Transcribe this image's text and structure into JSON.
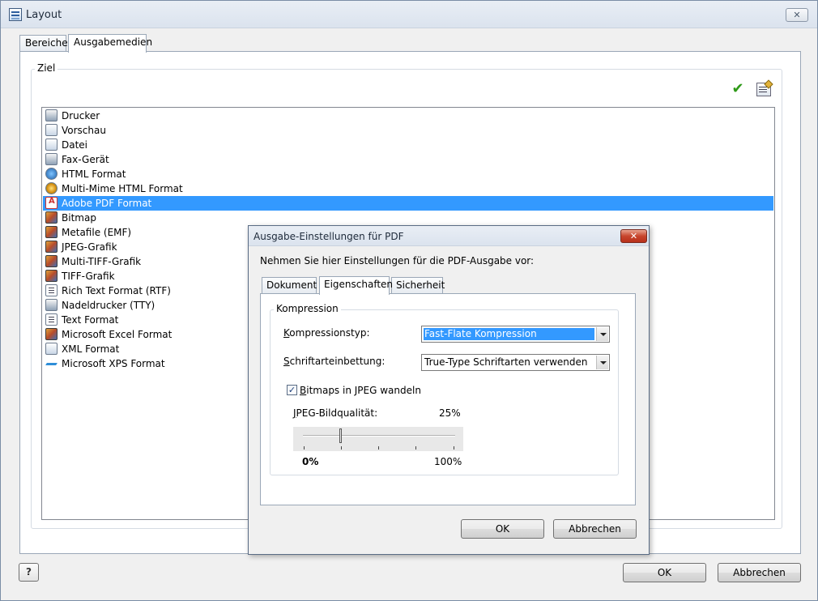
{
  "window": {
    "title": "Layout",
    "close_glyph": "✕",
    "help_glyph": "?",
    "ok_label": "OK",
    "cancel_label": "Abbrechen"
  },
  "main_tabs": [
    {
      "label": "Bereiche",
      "active": false
    },
    {
      "label": "Ausgabemedien",
      "active": true
    }
  ],
  "target_group": {
    "title": "Ziel",
    "check_glyph": "✔",
    "items": [
      {
        "label": "Drucker",
        "icon": "printer-icon"
      },
      {
        "label": "Vorschau",
        "icon": "preview-icon"
      },
      {
        "label": "Datei",
        "icon": "file-icon"
      },
      {
        "label": "Fax-Gerät",
        "icon": "fax-icon"
      },
      {
        "label": "HTML Format",
        "icon": "html-icon"
      },
      {
        "label": "Multi-Mime HTML Format",
        "icon": "mime-icon"
      },
      {
        "label": "Adobe PDF Format",
        "icon": "pdf-icon",
        "selected": true
      },
      {
        "label": "Bitmap",
        "icon": "bitmap-icon"
      },
      {
        "label": "Metafile (EMF)",
        "icon": "metafile-icon"
      },
      {
        "label": "JPEG-Grafik",
        "icon": "jpeg-icon"
      },
      {
        "label": "Multi-TIFF-Grafik",
        "icon": "multi-tiff-icon"
      },
      {
        "label": "TIFF-Grafik",
        "icon": "tiff-icon"
      },
      {
        "label": "Rich Text Format (RTF)",
        "icon": "rtf-icon"
      },
      {
        "label": "Nadeldrucker (TTY)",
        "icon": "dot-matrix-icon"
      },
      {
        "label": "Text Format",
        "icon": "text-icon"
      },
      {
        "label": "Microsoft Excel Format",
        "icon": "excel-icon"
      },
      {
        "label": "XML Format",
        "icon": "xml-icon"
      },
      {
        "label": "Microsoft XPS Format",
        "icon": "xps-icon"
      }
    ]
  },
  "dialog": {
    "title": "Ausgabe-Einstellungen für PDF",
    "close_glyph": "✕",
    "description": "Nehmen Sie hier Einstellungen für die PDF-Ausgabe vor:",
    "tabs": [
      {
        "label": "Dokument",
        "active": false
      },
      {
        "label": "Eigenschaften",
        "active": true
      },
      {
        "label": "Sicherheit",
        "active": false
      }
    ],
    "compression_group": {
      "title": "Kompression",
      "compression_type_accel": "K",
      "compression_type_rest": "ompressionstyp:",
      "compression_type_value": "Fast-Flate Kompression",
      "font_embedding_accel": "S",
      "font_embedding_rest": "chriftarteinbettung:",
      "font_embedding_value": "True-Type Schriftarten verwenden",
      "bitmap_checkbox_accel": "B",
      "bitmap_checkbox_rest": "itmaps in JPEG wandeln",
      "bitmap_checked": true,
      "check_glyph": "✓",
      "jpeg_quality_accel": "J",
      "jpeg_quality_rest": "PEG-Bildqualität:",
      "jpeg_quality_value": "25%",
      "jpeg_quality_percent": 25,
      "slider_min_label": "0%",
      "slider_max_label": "100%"
    },
    "ok_label": "OK",
    "cancel_label": "Abbrechen"
  },
  "colors": {
    "selection": "#3399ff",
    "check_green": "#2e9a18",
    "dialog_close_red": "#c7452c"
  }
}
